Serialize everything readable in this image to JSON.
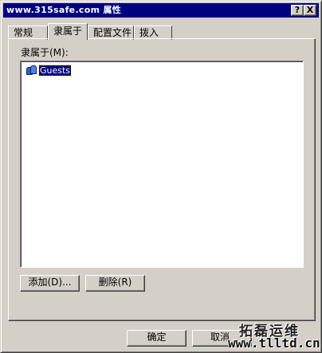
{
  "window": {
    "title": "www.315safe.com 属性",
    "help_label": "?",
    "close_label": "X"
  },
  "tabs": [
    {
      "label": "常规",
      "active": false
    },
    {
      "label": "隶属于",
      "active": true
    },
    {
      "label": "配置文件",
      "active": false
    },
    {
      "label": "拨入",
      "active": false
    }
  ],
  "memberof": {
    "label": "隶属于(M):",
    "items": [
      {
        "label": "Guests",
        "icon": "group-icon",
        "selected": true
      }
    ],
    "add_label": "添加(D)...",
    "remove_label": "删除(R)"
  },
  "footer": {
    "ok_label": "确定",
    "cancel_label": "取消"
  },
  "watermark": {
    "line1": "拓磊运维",
    "line2": "www.tlltd.cn"
  },
  "colors": {
    "titlebar": "#000080",
    "face": "#d4d0c8",
    "selection": "#000080"
  }
}
